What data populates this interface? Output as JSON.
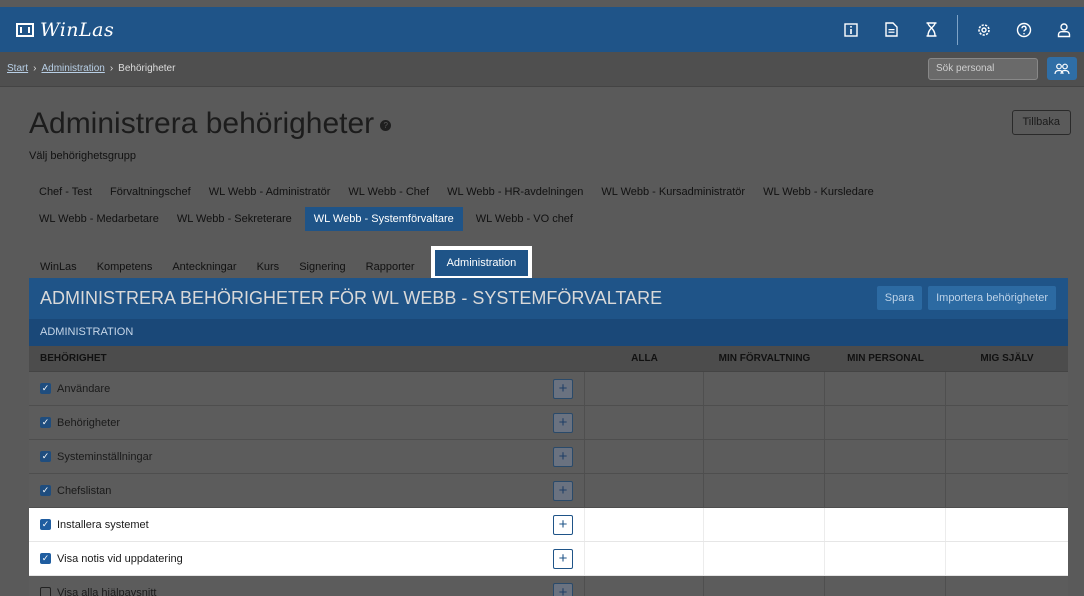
{
  "app": {
    "logo": "WinLas"
  },
  "topbar": {
    "icons": [
      "info-icon",
      "document-icon",
      "hourglass-icon",
      "gear-icon",
      "help-icon",
      "user-icon"
    ]
  },
  "breadcrumb": {
    "start": "Start",
    "admin": "Administration",
    "current": "Behörigheter"
  },
  "search": {
    "placeholder": "Sök personal"
  },
  "page": {
    "title": "Administrera behörigheter",
    "subtitle": "Välj behörighetsgrupp",
    "back_label": "Tillbaka"
  },
  "groups_row1": [
    "Chef - Test",
    "Förvaltningschef",
    "WL Webb - Administratör",
    "WL Webb - Chef",
    "WL Webb - HR-avdelningen",
    "WL Webb - Kursadministratör",
    "WL Webb - Kursledare"
  ],
  "groups_row2": [
    "WL Webb - Medarbetare",
    "WL Webb - Sekreterare",
    "WL Webb - Systemförvaltare",
    "WL Webb - VO chef"
  ],
  "active_group": "WL Webb - Systemförvaltare",
  "tabs": [
    "WinLas",
    "Kompetens",
    "Anteckningar",
    "Kurs",
    "Signering",
    "Rapporter",
    "Administration"
  ],
  "panel": {
    "title": "ADMINISTRERA BEHÖRIGHETER FÖR WL WEBB - SYSTEMFÖRVALTARE",
    "save_label": "Spara",
    "import_label": "Importera behörigheter",
    "section": "ADMINISTRATION",
    "columns": [
      "BEHÖRIGHET",
      "ALLA",
      "MIN FÖRVALTNING",
      "MIN PERSONAL",
      "MIG SJÄLV"
    ],
    "rows": [
      {
        "label": "Användare",
        "checked": true
      },
      {
        "label": "Behörigheter",
        "checked": true
      },
      {
        "label": "Systeminställningar",
        "checked": true
      },
      {
        "label": "Chefslistan",
        "checked": true
      },
      {
        "label": "Installera systemet",
        "checked": true
      },
      {
        "label": "Visa notis vid uppdatering",
        "checked": true
      },
      {
        "label": "Visa alla hjälpavsnitt",
        "checked": false
      }
    ]
  }
}
